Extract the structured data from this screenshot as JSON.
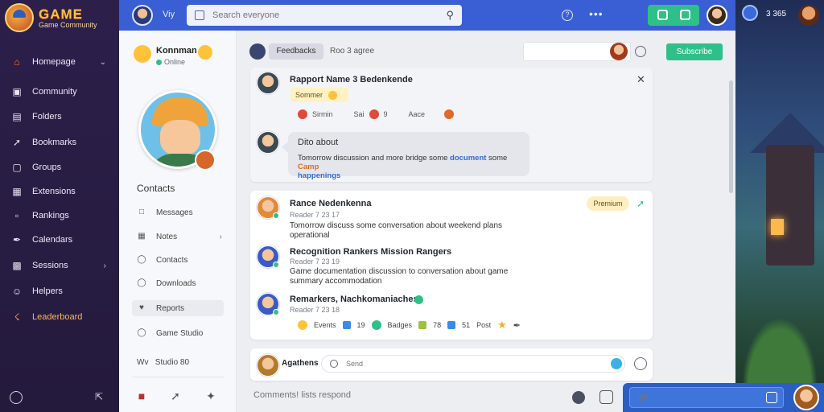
{
  "app": {
    "logo_title": "GAME",
    "logo_subtitle": "Game Community"
  },
  "topbar": {
    "label": "Viy",
    "search_placeholder": "Search everyone",
    "accent": "#3a5fd4",
    "green": "#2fc08a"
  },
  "nav": {
    "items": [
      {
        "label": "Homepage",
        "icon": "home-icon"
      },
      {
        "label": "Community",
        "icon": "door-icon"
      },
      {
        "label": "Folders",
        "icon": "folder-icon"
      },
      {
        "label": "Bookmarks",
        "icon": "rocket-icon"
      },
      {
        "label": "Groups",
        "icon": "chat-icon"
      },
      {
        "label": "Extensions",
        "icon": "puzzle-icon"
      },
      {
        "label": "Rankings",
        "icon": "chart-icon"
      },
      {
        "label": "Calendars",
        "icon": "link-icon"
      },
      {
        "label": "Sessions",
        "icon": "bookmark-icon"
      },
      {
        "label": "Helpers",
        "icon": "smile-icon"
      },
      {
        "label": "Leaderboard",
        "icon": "trophy-icon"
      }
    ]
  },
  "right_panel": {
    "count": "3 365"
  },
  "profile": {
    "name": "Konnman",
    "status": "Online",
    "section_title": "Contacts",
    "menu": [
      {
        "label": "Messages",
        "icon": "chat-icon"
      },
      {
        "label": "Notes",
        "icon": "calendar-icon"
      },
      {
        "label": "Contacts",
        "icon": "contacts-icon"
      },
      {
        "label": "Downloads",
        "icon": "download-icon"
      },
      {
        "label": "Reports",
        "icon": "heart-icon"
      },
      {
        "label": "Game Studio",
        "icon": "globe-icon"
      }
    ],
    "footer": "Studio 80",
    "footer_prefix": "Wv"
  },
  "feed_bar": {
    "pill": "Feedbacks",
    "label": "Roo 3 agree",
    "button": "Subscribe"
  },
  "card1": {
    "title": "Rapport Name 3 Bedenkende",
    "tag": "Sommer",
    "reactions": [
      "Sirmin",
      "Sai",
      "9",
      "Aace"
    ],
    "reply_title": "Dito about",
    "reply_text_1": "Tomorrow discussion and more bridge some ",
    "reply_link": "document",
    "reply_mid": " some ",
    "reply_orange": "Camp",
    "reply_text_2": "happenings"
  },
  "card2": {
    "tag": "Premium",
    "posts": [
      {
        "name": "Rance Nedenkenna",
        "meta": "Reader 7 23 17",
        "text": "Tomorrow discuss some conversation about weekend plans operational"
      },
      {
        "name": "Recognition Rankers Mission Rangers",
        "meta": "Reader 7 23 19",
        "text": "Game documentation discussion to conversation about game summary accommodation"
      },
      {
        "name": "Remarkers, Nachkomaniaches",
        "meta": "Reader 7 23 18",
        "text": ""
      }
    ],
    "badges": [
      {
        "label": "Events",
        "kind": "emoji"
      },
      {
        "label": "19",
        "kind": "blue"
      },
      {
        "label": "Badges",
        "kind": "green"
      },
      {
        "label": "78",
        "kind": "yellow"
      },
      {
        "label": "51",
        "kind": "blue"
      },
      {
        "label": "Post",
        "kind": "star"
      }
    ]
  },
  "card3": {
    "name": "Agathens",
    "search_placeholder": "Send"
  },
  "compose": {
    "placeholder": "Comments! lists respond",
    "chat_placeholder": "Ige"
  }
}
